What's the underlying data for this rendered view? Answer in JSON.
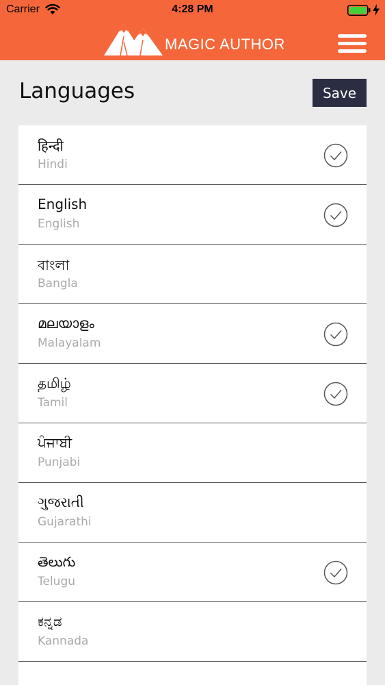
{
  "status_bar": {
    "carrier": "Carrier",
    "time": "4:28 PM"
  },
  "header": {
    "brand": "MAGIC AUTHOR",
    "background_color": "#f5673a"
  },
  "page": {
    "title": "Languages",
    "save_label": "Save"
  },
  "languages": [
    {
      "native": "हिन्दी",
      "english": "Hindi",
      "selected": true
    },
    {
      "native": "English",
      "english": "English",
      "selected": true
    },
    {
      "native": "বাংলা",
      "english": "Bangla",
      "selected": false
    },
    {
      "native": "മലയാളം",
      "english": "Malayalam",
      "selected": true
    },
    {
      "native": "தமிழ்",
      "english": "Tamil",
      "selected": true
    },
    {
      "native": "ਪੰਜਾਬੀ",
      "english": "Punjabi",
      "selected": false
    },
    {
      "native": "ગુજરાતી",
      "english": "Gujarathi",
      "selected": false
    },
    {
      "native": "తెలుగు",
      "english": "Telugu",
      "selected": true
    },
    {
      "native": "ಕನ್ನಡ",
      "english": "Kannada",
      "selected": false
    }
  ],
  "colors": {
    "accent": "#f5673a",
    "save_button": "#2b2d42",
    "secondary_text": "#aaaaaa",
    "battery": "#3fd339"
  }
}
